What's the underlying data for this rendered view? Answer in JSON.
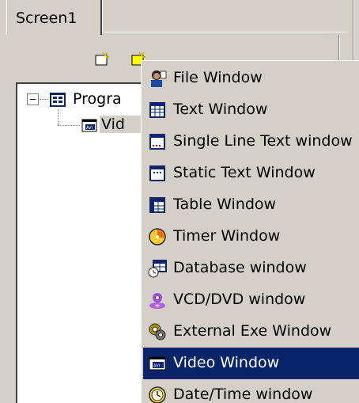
{
  "tabs": [
    {
      "label": "Screen1"
    }
  ],
  "tree": {
    "root_label": "Progra",
    "child_label": "Vid"
  },
  "menu": {
    "items": [
      {
        "label": "File Window",
        "icon": "person-icon"
      },
      {
        "label": "Text Window",
        "icon": "grid-icon"
      },
      {
        "label": "Single Line Text window",
        "icon": "single-line-text-icon"
      },
      {
        "label": "Static Text Window",
        "icon": "static-text-icon"
      },
      {
        "label": "Table Window",
        "icon": "table-icon"
      },
      {
        "label": "Timer Window",
        "icon": "timer-icon"
      },
      {
        "label": "Database window",
        "icon": "database-icon"
      },
      {
        "label": "VCD/DVD window",
        "icon": "disc-player-icon"
      },
      {
        "label": "External Exe Window",
        "icon": "gears-icon"
      },
      {
        "label": "Video Window",
        "icon": "video-icon",
        "highlighted": true
      },
      {
        "label": "Date/Time window",
        "icon": "clock-icon"
      }
    ]
  },
  "colors": {
    "highlight": "#0a246a",
    "face": "#d4d0c8"
  }
}
